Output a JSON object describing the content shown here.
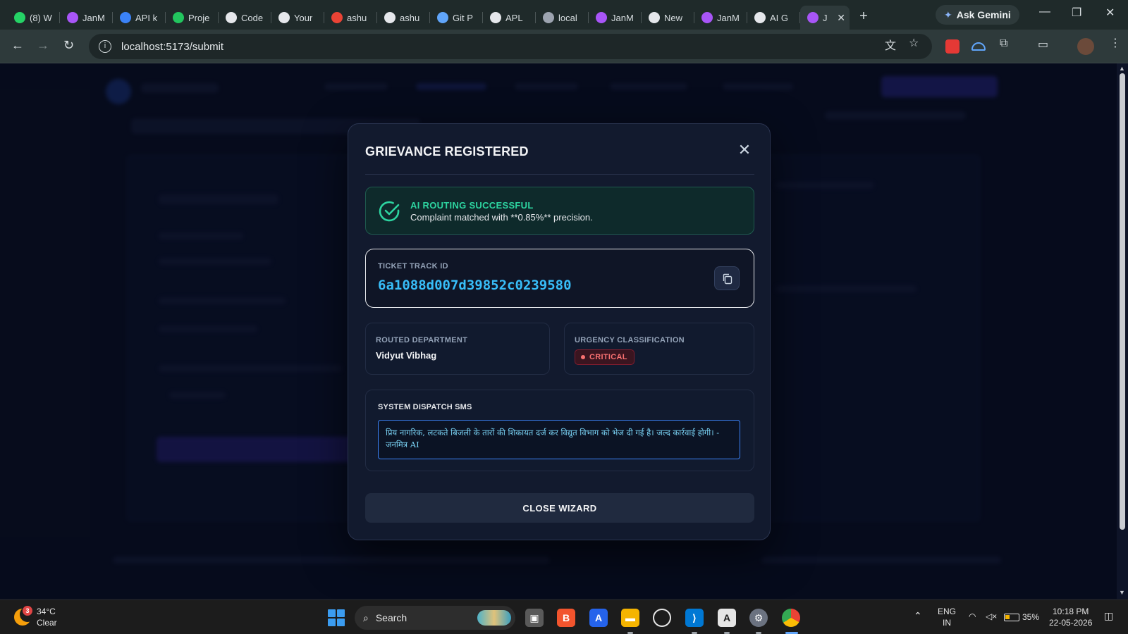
{
  "browser": {
    "tabs": [
      {
        "title": "(8) W",
        "icon": "whatsapp-icon",
        "color": "#25d366"
      },
      {
        "title": "JanM",
        "icon": "bolt-icon",
        "color": "#a855f7"
      },
      {
        "title": "API k",
        "icon": "stack-icon",
        "color": "#3b82f6"
      },
      {
        "title": "Proje",
        "icon": "leaf-icon",
        "color": "#22c55e"
      },
      {
        "title": "Code",
        "icon": "github-icon",
        "color": "#e5e7eb"
      },
      {
        "title": "Your",
        "icon": "github-icon",
        "color": "#e5e7eb"
      },
      {
        "title": "ashu",
        "icon": "gmail-icon",
        "color": "#ea4335"
      },
      {
        "title": "ashu",
        "icon": "github-icon",
        "color": "#e5e7eb"
      },
      {
        "title": "Git P",
        "icon": "gemini-icon",
        "color": "#60a5fa"
      },
      {
        "title": "APL",
        "icon": "render-icon",
        "color": "#e5e7eb"
      },
      {
        "title": "local",
        "icon": "globe-icon",
        "color": "#9ca3af"
      },
      {
        "title": "JanM",
        "icon": "bolt-icon",
        "color": "#a855f7"
      },
      {
        "title": "New",
        "icon": "chatgpt-icon",
        "color": "#e5e7eb"
      },
      {
        "title": "JanM",
        "icon": "bolt-icon",
        "color": "#a855f7"
      },
      {
        "title": "AI G",
        "icon": "chatgpt-icon",
        "color": "#e5e7eb"
      },
      {
        "title": "J",
        "icon": "bolt-icon",
        "color": "#a855f7",
        "active": true
      }
    ],
    "ask_gemini": "Ask Gemini",
    "url": "localhost:5173/submit"
  },
  "modal": {
    "title": "GRIEVANCE REGISTERED",
    "success_title": "AI ROUTING SUCCESSFUL",
    "success_text": "Complaint matched with **0.85%** precision.",
    "ticket_label": "TICKET TRACK ID",
    "ticket_id": "6a1088d007d39852c0239580",
    "department_label": "ROUTED DEPARTMENT",
    "department_value": "Vidyut Vibhag",
    "urgency_label": "URGENCY CLASSIFICATION",
    "urgency_value": "CRITICAL",
    "sms_label": "SYSTEM DISPATCH SMS",
    "sms_text": "प्रिय नागरिक, लटकते बिजली के तारों की शिकायत दर्ज कर विद्युत विभाग को भेज दी गई है। जल्द कार्रवाई होगी। - जनमित्र AI",
    "close_label": "CLOSE WIZARD"
  },
  "taskbar": {
    "weather_temp": "34°C",
    "weather_desc": "Clear",
    "weather_alert_count": "3",
    "search_label": "Search",
    "lang_top": "ENG",
    "lang_bottom": "IN",
    "battery": "35%",
    "time": "10:18 PM",
    "date": "22-05-2026"
  },
  "colors": {
    "accent_success": "#2dd4a0",
    "ticket_id": "#38bdf8",
    "critical": "#f87171"
  }
}
